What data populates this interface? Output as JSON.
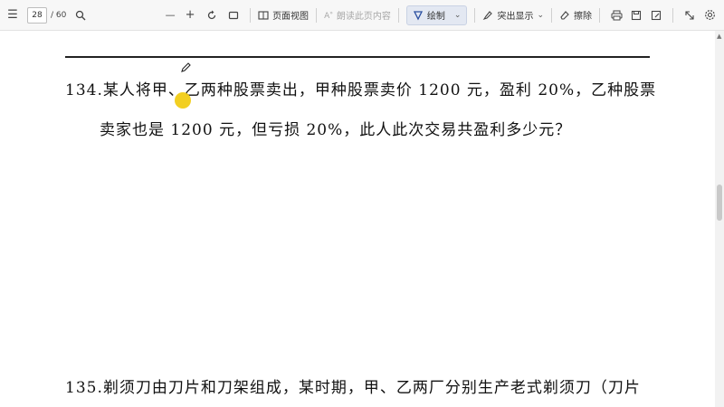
{
  "toolbar": {
    "menu_icon": "☰",
    "page_current": "28",
    "page_total": "/ 60",
    "zoom_out": "—",
    "zoom_in": "+",
    "page_view_label": "页面视图",
    "read_aloud_label": "朗读此页内容",
    "draw_label": "绘制",
    "highlight_label": "突出显示",
    "erase_label": "擦除"
  },
  "document": {
    "q134_line1": "134.某人将甲、乙两种股票卖出，甲种股票卖价 1200 元，盈利 20%，乙种股票",
    "q134_line2": "卖家也是 1200 元，但亏损 20%，此人此次交易共盈利多少元？",
    "q135_line1": "135.剃须刀由刀片和刀架组成，某时期，甲、乙两厂分别生产老式剃须刀（刀片"
  },
  "colors": {
    "cursor_highlight": "#f1cc16",
    "toolbar_bg": "#f7f7f7",
    "draw_active_bg": "#e3e8f2"
  }
}
